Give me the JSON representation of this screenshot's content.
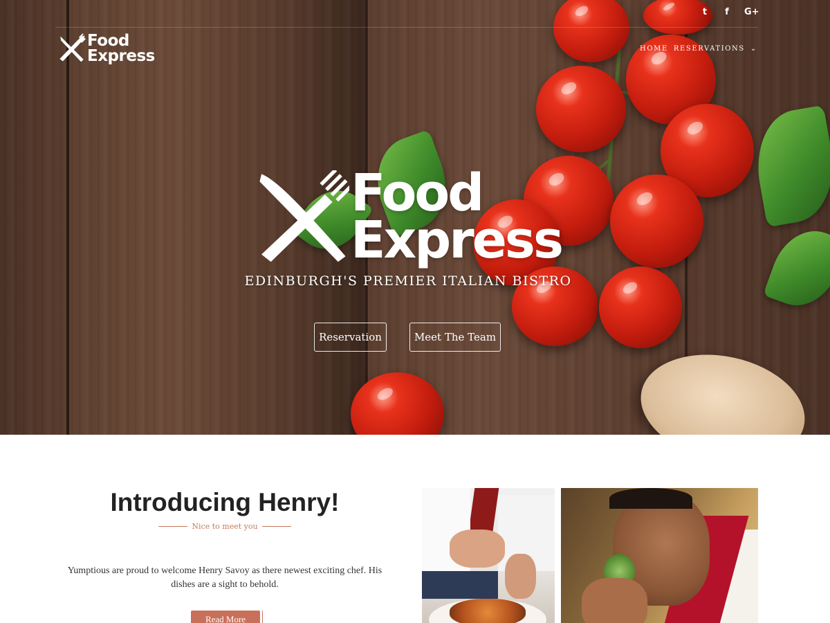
{
  "brand": {
    "line1": "Food",
    "line2": "Express"
  },
  "social": [
    {
      "icon": "twitter-icon",
      "glyph": "t"
    },
    {
      "icon": "facebook-icon",
      "glyph": "f"
    },
    {
      "icon": "google-plus-icon",
      "glyph": "G+"
    }
  ],
  "nav": {
    "items": [
      {
        "label": "Home"
      },
      {
        "label": "Reservations",
        "has_dropdown": true
      }
    ]
  },
  "hero": {
    "tagline": "Edinburgh's Premier Italian Bistro",
    "buttons": [
      {
        "label": "Reservation"
      },
      {
        "label": "Meet The Team"
      }
    ]
  },
  "intro": {
    "title": "Introducing Henry!",
    "subtitle": "Nice to meet you",
    "text": "Yumptious are proud to welcome Henry Savoy as there newest exciting chef. His dishes are a sight to behold.",
    "button": "Read More"
  },
  "colors": {
    "accent": "#c8705a",
    "heading": "#222222",
    "body_text": "#333333"
  }
}
